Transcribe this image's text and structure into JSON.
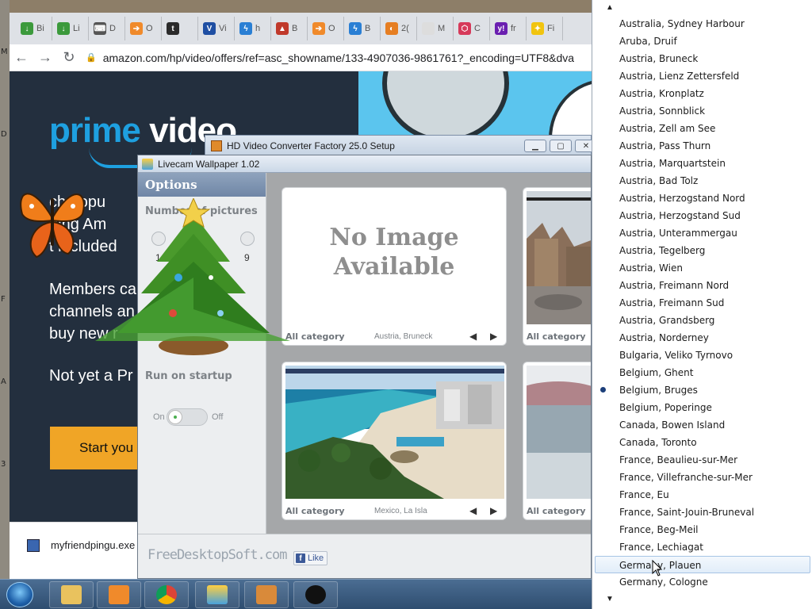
{
  "desktop_letters": [
    "M",
    "D",
    "F",
    "A",
    "3"
  ],
  "browser": {
    "tabs": [
      {
        "letter": "Bi",
        "color": "#3c9a3c",
        "glyph": "↓"
      },
      {
        "letter": "Li",
        "color": "#3c9a3c",
        "glyph": "↓"
      },
      {
        "letter": "D",
        "color": "#555555",
        "glyph": "⌨"
      },
      {
        "letter": "O",
        "color": "#f08a2b",
        "glyph": "➔"
      },
      {
        "letter": "",
        "color": "#2b2b2b",
        "glyph": "t"
      },
      {
        "letter": "Vi",
        "color": "#1f4fa3",
        "glyph": "V"
      },
      {
        "letter": "h",
        "color": "#2a7fd4",
        "glyph": "ϟ"
      },
      {
        "letter": "B",
        "color": "#c0392b",
        "glyph": "▲"
      },
      {
        "letter": "O",
        "color": "#f08a2b",
        "glyph": "➔"
      },
      {
        "letter": "B",
        "color": "#2a7fd4",
        "glyph": "ϟ"
      },
      {
        "letter": "2(",
        "color": "#e67e22",
        "glyph": "◐"
      },
      {
        "letter": "M",
        "color": "#dddddd",
        "glyph": ""
      },
      {
        "letter": "C",
        "color": "#d63a5a",
        "glyph": "⬡"
      },
      {
        "letter": "fr",
        "color": "#6a1fb0",
        "glyph": "y!"
      },
      {
        "letter": "Fi",
        "color": "#f1c40f",
        "glyph": "✦"
      }
    ],
    "url": "amazon.com/hp/video/offers/ref=asc_showname/133-4907036-9861761?_encoding=UTF8&dva",
    "page": {
      "logo_part1": "prime",
      "logo_part2": "video",
      "line1": "ch popu",
      "line2": "ning Am",
      "line3": "t included",
      "line4": "Members ca",
      "line5": "channels an",
      "line6": "buy new r",
      "line7": "Not yet a Pr",
      "start_button": "Start you"
    },
    "download": {
      "filename": "myfriendpingu.exe"
    }
  },
  "hd_window": {
    "title": "HD Video Converter Factory 25.0 Setup"
  },
  "livecam": {
    "title": "Livecam Wallpaper 1.02",
    "options_header": "Options",
    "number_label": "Number of pictures",
    "radio_min": "1",
    "radio_max": "9",
    "startup_label": "Run on startup",
    "toggle_on": "On",
    "toggle_off": "Off",
    "cards": [
      {
        "no_image_line1": "No Image",
        "no_image_line2": "Available",
        "category": "All category",
        "location": "Austria, Bruneck"
      },
      {
        "category": "All category"
      },
      {
        "category": "All category",
        "location": "Mexico, La Isla"
      },
      {
        "category": "All category"
      }
    ],
    "footer_brand": "FreeDesktopSoft.com",
    "like_label": "Like"
  },
  "dropdown": {
    "items": [
      "Australia, Sydney Harbour",
      "Aruba, Druif",
      "Austria, Bruneck",
      "Austria, Lienz Zettersfeld",
      "Austria, Kronplatz",
      "Austria, Sonnblick",
      "Austria, Zell am See",
      "Austria, Pass Thurn",
      "Austria, Marquartstein",
      "Austria, Bad Tolz",
      "Austria, Herzogstand Nord",
      "Austria, Herzogstand Sud",
      "Austria, Unterammergau",
      "Austria, Tegelberg",
      "Austria, Wien",
      "Austria, Freimann Nord",
      "Austria, Freimann Sud",
      "Austria, Grandsberg",
      "Austria, Norderney",
      "Bulgaria, Veliko Tyrnovo",
      "Belgium, Ghent",
      "Belgium, Bruges",
      "Belgium, Poperinge",
      "Canada, Bowen Island",
      "Canada, Toronto",
      "France, Beaulieu-sur-Mer",
      "France, Villefranche-sur-Mer",
      "France, Eu",
      "France, Saint-Jouin-Bruneval",
      "France, Beg-Meil",
      "France, Lechiagat",
      "Germany, Plauen",
      "Germany, Cologne"
    ],
    "selected": "Belgium, Bruges",
    "hovered": "Germany, Plauen"
  },
  "colors": {
    "prime_blue": "#1ea0e0",
    "amazon_dark": "#232f3e",
    "start_orange": "#f0a526"
  }
}
